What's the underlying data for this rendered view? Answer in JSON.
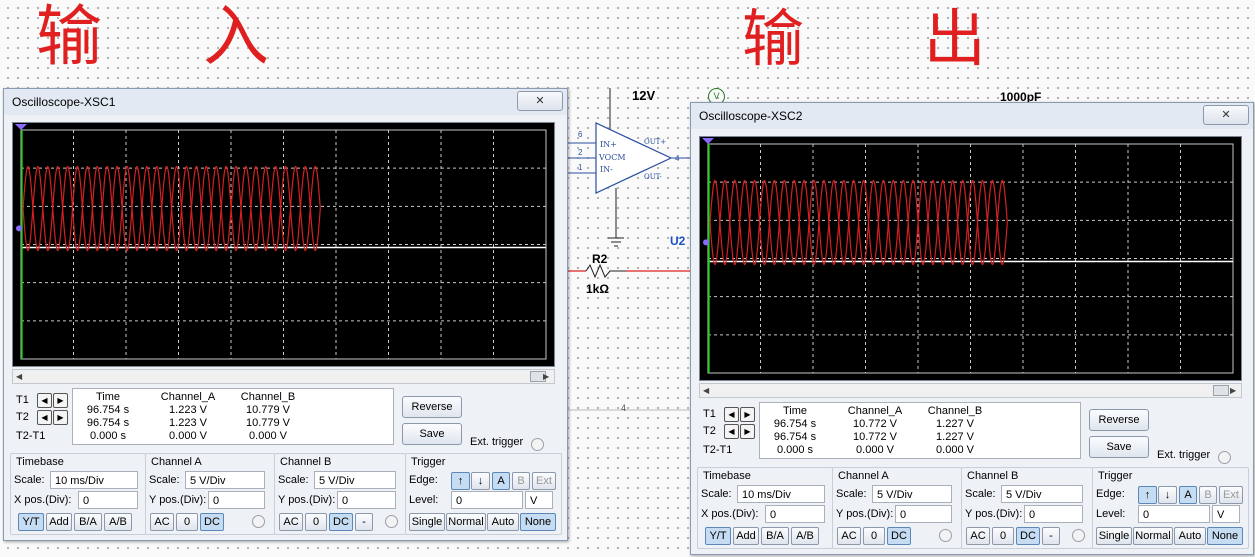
{
  "annotations": {
    "input_label": "输 入",
    "output_label": "输 出"
  },
  "circuit": {
    "supply_label": "12V",
    "cap_label": "1000pF",
    "opamp_text": "VOCM",
    "opamp_in_plus": "IN+",
    "opamp_in_minus": "IN-",
    "opamp_out_plus": "OUT+",
    "opamp_out_minus": "OUT-",
    "pin_1": "1",
    "pin_2": "2",
    "pin_4": "4",
    "pin_6": "6",
    "u_label": "U2",
    "r_name": "R2",
    "r_value": "1kΩ",
    "voltmeter": "V",
    "bottom_num": "4"
  },
  "scopes": [
    {
      "title": "Oscilloscope-XSC1",
      "close": "✕",
      "readout": {
        "headers": [
          "Time",
          "Channel_A",
          "Channel_B"
        ],
        "rows": [
          {
            "label": "T1",
            "time": "96.754 s",
            "a": "1.223 V",
            "b": "10.779 V"
          },
          {
            "label": "T2",
            "time": "96.754 s",
            "a": "1.223 V",
            "b": "10.779 V"
          },
          {
            "label": "T2-T1",
            "time": "0.000 s",
            "a": "0.000 V",
            "b": "0.000 V"
          }
        ]
      },
      "reverse": "Reverse",
      "save": "Save",
      "ext_trigger": "Ext. trigger",
      "timebase": {
        "title": "Timebase",
        "scale_label": "Scale:",
        "scale": "10 ms/Div",
        "xpos_label": "X pos.(Div):",
        "xpos": "0",
        "buttons": [
          "Y/T",
          "Add",
          "B/A",
          "A/B"
        ]
      },
      "channel_a": {
        "title": "Channel A",
        "scale_label": "Scale:",
        "scale": "5  V/Div",
        "ypos_label": "Y pos.(Div):",
        "ypos": "0",
        "buttons": [
          "AC",
          "0",
          "DC"
        ]
      },
      "channel_b": {
        "title": "Channel B",
        "scale_label": "Scale:",
        "scale": "5  V/Div",
        "ypos_label": "Y pos.(Div):",
        "ypos": "0",
        "buttons": [
          "AC",
          "0",
          "DC",
          "-"
        ]
      },
      "trigger": {
        "title": "Trigger",
        "edge_label": "Edge:",
        "edges": [
          "↑",
          "↓",
          "A",
          "B",
          "Ext"
        ],
        "level_label": "Level:",
        "level": "0",
        "level_unit": "V",
        "modes": [
          "Single",
          "Normal",
          "Auto",
          "None"
        ]
      }
    },
    {
      "title": "Oscilloscope-XSC2",
      "close": "✕",
      "readout": {
        "headers": [
          "Time",
          "Channel_A",
          "Channel_B"
        ],
        "rows": [
          {
            "label": "T1",
            "time": "96.754 s",
            "a": "10.772 V",
            "b": "1.227 V"
          },
          {
            "label": "T2",
            "time": "96.754 s",
            "a": "10.772 V",
            "b": "1.227 V"
          },
          {
            "label": "T2-T1",
            "time": "0.000 s",
            "a": "0.000 V",
            "b": "0.000 V"
          }
        ]
      },
      "reverse": "Reverse",
      "save": "Save",
      "ext_trigger": "Ext. trigger",
      "timebase": {
        "title": "Timebase",
        "scale_label": "Scale:",
        "scale": "10 ms/Div",
        "xpos_label": "X pos.(Div):",
        "xpos": "0",
        "buttons": [
          "Y/T",
          "Add",
          "B/A",
          "A/B"
        ]
      },
      "channel_a": {
        "title": "Channel A",
        "scale_label": "Scale:",
        "scale": "5  V/Div",
        "ypos_label": "Y pos.(Div):",
        "ypos": "0",
        "buttons": [
          "AC",
          "0",
          "DC"
        ]
      },
      "channel_b": {
        "title": "Channel B",
        "scale_label": "Scale:",
        "scale": "5  V/Div",
        "ypos_label": "Y pos.(Div):",
        "ypos": "0",
        "buttons": [
          "AC",
          "0",
          "DC",
          "-"
        ]
      },
      "trigger": {
        "title": "Trigger",
        "edge_label": "Edge:",
        "edges": [
          "↑",
          "↓",
          "A",
          "B",
          "Ext"
        ],
        "level_label": "Level:",
        "level": "0",
        "level_unit": "V",
        "modes": [
          "Single",
          "Normal",
          "Auto",
          "None"
        ]
      }
    }
  ],
  "colors": {
    "trace": "#d42020",
    "grid": "#c8c8c8",
    "screen": "#000000",
    "axis": "#00c800",
    "baseline": "#ffffff"
  }
}
